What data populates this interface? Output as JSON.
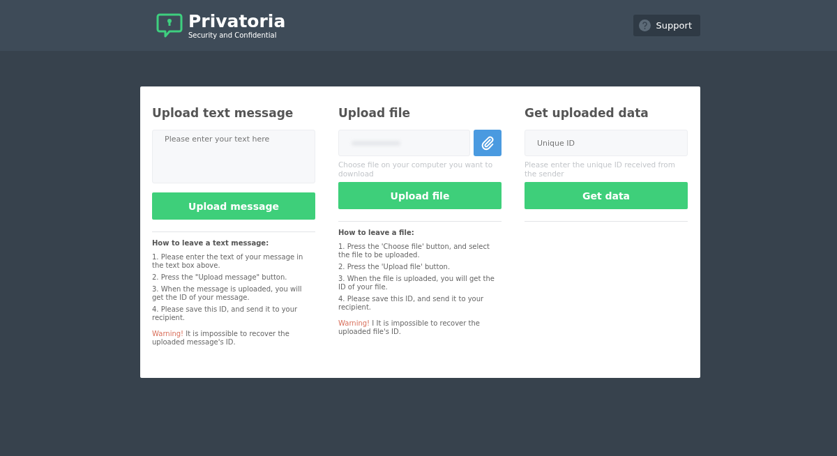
{
  "header": {
    "logo_title": "Privatoria",
    "logo_subtitle": "Security and Confidential",
    "support_button": "Support"
  },
  "columns": [
    {
      "kind": "textarea",
      "title": "Upload text message",
      "placeholder": "Please enter your text here",
      "button": "Upload message",
      "instructions": {
        "heading": "How to leave a text message:",
        "steps": [
          "1. Please enter the text of your message in the text box above.",
          "2. Press the \"Upload message\" button.",
          "3. When the message is uploaded, you will get the ID of your message.",
          "4. Please save this ID, and send it to your recipient."
        ],
        "warning_label": "Warning!",
        "warning_text": "It is impossible to recover the uploaded message's ID."
      }
    },
    {
      "kind": "file",
      "title": "Upload file",
      "hint": "Choose file on your computer you want to download",
      "button": "Upload file",
      "instructions": {
        "heading": "How to leave a file:",
        "steps": [
          "1. Press the 'Choose file' button, and select the file to be uploaded.",
          "2. Press the 'Upload file' button.",
          "3. When the file is uploaded, you will get the ID of your file.",
          "4. Please save this ID, and send it to your recipient."
        ],
        "warning_label": "Warning!",
        "warning_text": "I It is impossible to recover the uploaded file's ID."
      }
    },
    {
      "kind": "input",
      "title": "Get uploaded data",
      "placeholder": "Unique ID",
      "hint": "Please enter the unique ID received from the sender",
      "button": "Get data"
    }
  ]
}
